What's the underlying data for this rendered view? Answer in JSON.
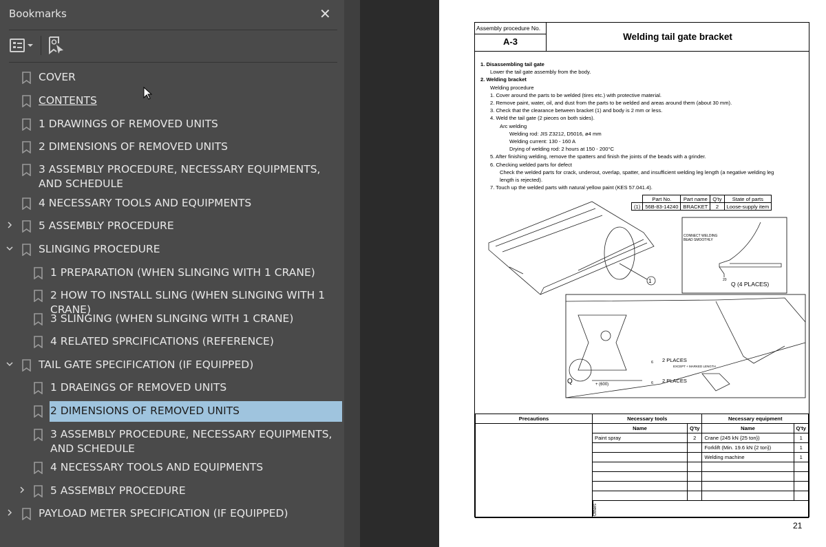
{
  "panel": {
    "title": "Bookmarks",
    "close_icon": "close-icon",
    "options_icon": "list-options-icon",
    "find_icon": "find-current-bookmark-icon"
  },
  "bookmarks": [
    {
      "label": "COVER",
      "level": 0,
      "chevron": ""
    },
    {
      "label": "CONTENTS",
      "level": 0,
      "chevron": "",
      "underline": true
    },
    {
      "label": "1 DRAWINGS OF REMOVED UNITS",
      "level": 0,
      "chevron": ""
    },
    {
      "label": "2 DIMENSIONS OF REMOVED UNITS",
      "level": 0,
      "chevron": ""
    },
    {
      "label": "3 ASSEMBLY PROCEDURE, NECESSARY EQUIPMENTS, AND SCHEDULE",
      "level": 0,
      "chevron": ""
    },
    {
      "label": "4 NECESSARY TOOLS AND EQUIPMENTS",
      "level": 0,
      "chevron": ""
    },
    {
      "label": "5 ASSEMBLY PROCEDURE",
      "level": 0,
      "chevron": "collapsed"
    },
    {
      "label": "SLINGING PROCEDURE",
      "level": 0,
      "chevron": "expanded"
    },
    {
      "label": "1 PREPARATION (WHEN SLINGING WITH 1 CRANE)",
      "level": 1,
      "chevron": ""
    },
    {
      "label": "2 HOW TO INSTALL SLING (WHEN SLINGING WITH 1 CRANE)",
      "level": 1,
      "chevron": ""
    },
    {
      "label": "3 SLINGING (WHEN SLINGING WITH 1 CRANE)",
      "level": 1,
      "chevron": ""
    },
    {
      "label": "4 RELATED SPRCIFICATIONS (REFERENCE)",
      "level": 1,
      "chevron": ""
    },
    {
      "label": "TAIL GATE SPECIFICATION (IF EQUIPPED)",
      "level": 0,
      "chevron": "expanded"
    },
    {
      "label": "1 DRAEINGS OF REMOVED UNITS",
      "level": 1,
      "chevron": ""
    },
    {
      "label": "2 DIMENSIONS OF REMOVED UNITS",
      "level": 1,
      "chevron": "",
      "selected": true
    },
    {
      "label": "3 ASSEMBLY PROCEDURE, NECESSARY EQUIPMENTS, AND SCHEDULE",
      "level": 1,
      "chevron": ""
    },
    {
      "label": "4 NECESSARY TOOLS AND EQUIPMENTS",
      "level": 1,
      "chevron": ""
    },
    {
      "label": "5 ASSEMBLY PROCEDURE",
      "level": 1,
      "chevron": "collapsed"
    },
    {
      "label": "PAYLOAD METER SPECIFICATION (IF EQUIPPED)",
      "level": 0,
      "chevron": "collapsed"
    }
  ],
  "document": {
    "proc_label": "Assembly procedure No.",
    "proc_no": "A-3",
    "title": "Welding tail gate bracket",
    "lines": [
      {
        "t": "1.  Disassembling tail gate",
        "bold": true,
        "ind": 0
      },
      {
        "t": "Lower the tail gate assembly from the body.",
        "ind": 1
      },
      {
        "t": "2.  Welding bracket",
        "bold": true,
        "ind": 0
      },
      {
        "t": "Welding procedure",
        "ind": 1
      },
      {
        "t": "1.   Cover around the parts to be welded (tires etc.) with protective material.",
        "ind": 1
      },
      {
        "t": "2.   Remove paint, water, oil, and dust from the parts to be welded and areas around them (about 30 mm).",
        "ind": 1
      },
      {
        "t": "3.   Check that the clearance between bracket (1) and body is 2 mm or less.",
        "ind": 1
      },
      {
        "t": "4.   Weld the tail gate (2 pieces on both sides).",
        "ind": 1
      },
      {
        "t": "Arc welding",
        "ind": 2
      },
      {
        "t": "Welding rod: JIS Z3212, D5016, ø4 mm",
        "ind": 3
      },
      {
        "t": "Welding current: 130 - 160 A",
        "ind": 3
      },
      {
        "t": "Drying of welding rod: 2 hours at 150 - 200°C",
        "ind": 3
      },
      {
        "t": "5.   After finishing welding, remove the spatters and finish the joints of the beads with a grinder.",
        "ind": 1
      },
      {
        "t": "6.   Checking welded parts for defect",
        "ind": 1
      },
      {
        "t": "Check the welded parts for crack, underout, overlap, spatter, and insufficient welding leg length (a negative welding leg",
        "ind": 2
      },
      {
        "t": "length is rejected).",
        "ind": 2
      },
      {
        "t": "7.   Touch up the welded parts with natural yellow paint (KES 57.041.4).",
        "ind": 1
      }
    ],
    "parts_table": {
      "headers": [
        "",
        "Part No.",
        "Part name",
        "Q'ty",
        "State of parts"
      ],
      "rows": [
        [
          "(1)",
          "56B-83-14240",
          "BRACKET",
          "2",
          "Loose-supply item"
        ]
      ]
    },
    "figure": {
      "callout": "1",
      "detail_note_1": "CONNECT WELDING",
      "detail_note_2": "BEAD SMOOTHLY",
      "detail_dim": "20",
      "detail_caption": "Q (4 PLACES)",
      "weld1": "2 PLACES",
      "weld1_note": "EXCEPT + MARKED LENGTH",
      "weld2": "2 PLACES",
      "weld_size": "6",
      "dim": "+ (600)",
      "q_label": "Q"
    },
    "bottom": {
      "precautions": "Precautions",
      "tools": "Necessary tools",
      "equipment": "Necessary equipment",
      "name": "Name",
      "qty": "Q'ty",
      "others": "Others",
      "tool_rows": [
        [
          "Paint spray",
          "2"
        ],
        [
          "",
          ""
        ],
        [
          "",
          ""
        ],
        [
          "",
          ""
        ],
        [
          "",
          ""
        ],
        [
          "",
          ""
        ],
        [
          "",
          ""
        ]
      ],
      "equip_rows": [
        [
          "Crane (245 kN {25 ton})",
          "1"
        ],
        [
          "Forklift (Min. 19.6 kN {2 ton})",
          "1"
        ],
        [
          "Welding machine",
          "1"
        ],
        [
          "",
          ""
        ],
        [
          "",
          ""
        ],
        [
          "",
          ""
        ],
        [
          "",
          ""
        ]
      ]
    }
  },
  "page_number": "21",
  "colors": {
    "panel": "#4a4a4a",
    "selected": "#9fc4de",
    "viewer_bg": "#2b2b2b"
  }
}
